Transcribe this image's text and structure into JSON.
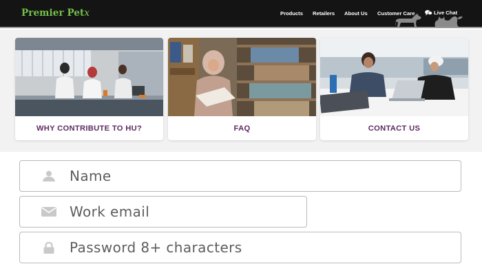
{
  "header": {
    "logo_main": "Premier Pet",
    "logo_tail": "x",
    "nav": {
      "products": "Products",
      "retailers": "Retailers",
      "about": "About Us",
      "customer_care": "Customer Care",
      "live_chat": "Live Chat"
    },
    "icons": {
      "chat": "chat-bubbles-icon",
      "pets": "cat-and-dog-silhouettes"
    },
    "colors": {
      "bar": "#141414",
      "logo": "#74c24a"
    }
  },
  "cards": [
    {
      "label": "WHY CONTRIBUTE TO HU?"
    },
    {
      "label": "FAQ"
    },
    {
      "label": "CONTACT US"
    }
  ],
  "cards_style": {
    "label_color": "#5e2a62"
  },
  "form": {
    "name": {
      "placeholder": "Name",
      "value": "",
      "icon": "person-icon"
    },
    "email": {
      "placeholder": "Work email",
      "value": "",
      "icon": "envelope-icon"
    },
    "password": {
      "placeholder": "Password 8+ characters",
      "value": "",
      "icon": "lock-icon"
    }
  }
}
